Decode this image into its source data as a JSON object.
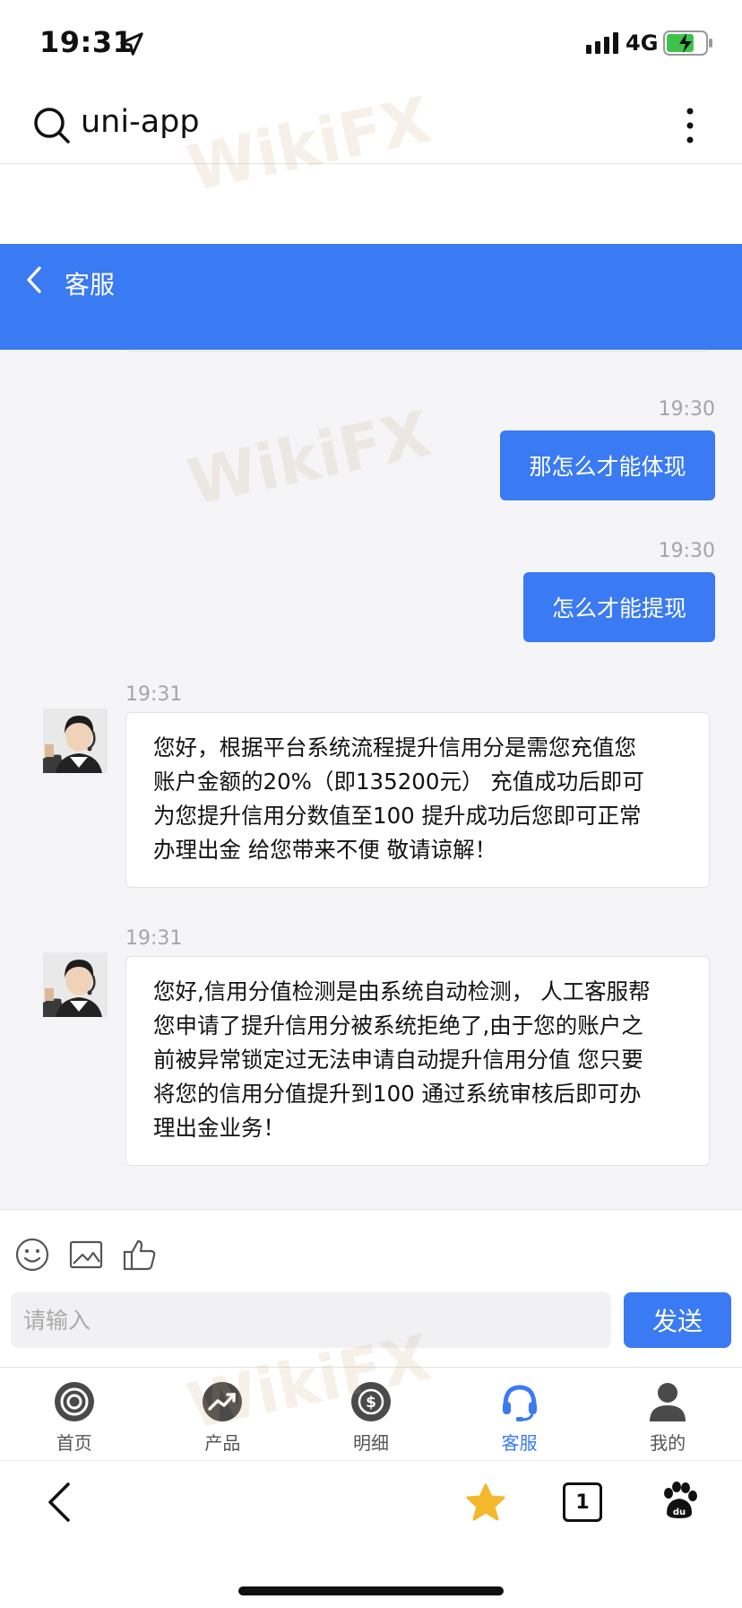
{
  "status_bar": {
    "time": "19:31",
    "network": "4G"
  },
  "browser": {
    "url_text": "uni-app"
  },
  "header": {
    "title": "客服"
  },
  "messages": [
    {
      "from": "user",
      "time": "19:30",
      "text": "那怎么才能体现"
    },
    {
      "from": "user",
      "time": "19:30",
      "text": "怎么才能提现"
    },
    {
      "from": "agent",
      "time": "19:31",
      "lines": [
        "您好，根据平台系统流程提升信用分是需您充值您",
        "账户金额的20%（即135200元） 充值成功后即可",
        "为您提升信用分数值至100 提升成功后您即可正常",
        "办理出金 给您带来不便 敬请谅解！"
      ]
    },
    {
      "from": "agent",
      "time": "19:31",
      "lines": [
        "您好,信用分值检测是由系统自动检测， 人工客服帮",
        "您申请了提升信用分被系统拒绝了,由于您的账户之",
        "前被异常锁定过无法申请自动提升信用分值 您只要",
        "将您的信用分值提升到100 通过系统审核后即可办",
        "理出金业务！"
      ]
    }
  ],
  "composer": {
    "placeholder": "请输入",
    "send_label": "发送"
  },
  "tabs": [
    {
      "label": "首页",
      "icon": "home-icon"
    },
    {
      "label": "产品",
      "icon": "chart-icon"
    },
    {
      "label": "明细",
      "icon": "dollar-icon"
    },
    {
      "label": "客服",
      "icon": "headset-icon",
      "active": true
    },
    {
      "label": "我的",
      "icon": "user-icon"
    }
  ],
  "browser_bar": {
    "tab_count": "1"
  },
  "watermark": "WikiFX",
  "colors": {
    "accent": "#3a7af3",
    "chat_bg": "#f5f5f7"
  }
}
